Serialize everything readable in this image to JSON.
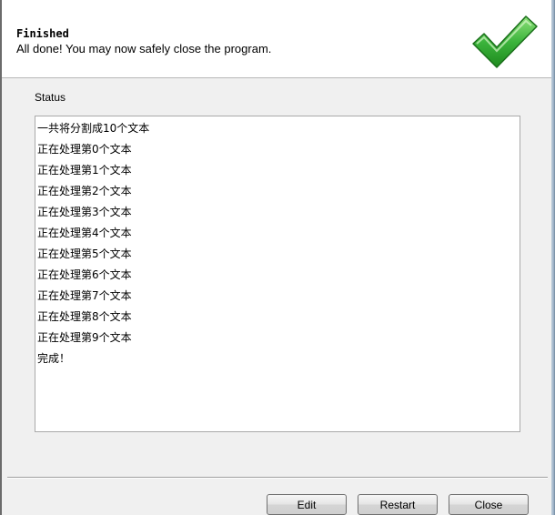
{
  "header": {
    "title": "Finished",
    "subtitle": "All done! You may now safely close the program.",
    "icon": "checkmark-icon",
    "icon_color": "#2ea52e"
  },
  "status": {
    "label": "Status",
    "lines": [
      "一共将分割成10个文本",
      "正在处理第0个文本",
      "正在处理第1个文本",
      "正在处理第2个文本",
      "正在处理第3个文本",
      "正在处理第4个文本",
      "正在处理第5个文本",
      "正在处理第6个文本",
      "正在处理第7个文本",
      "正在处理第8个文本",
      "正在处理第9个文本",
      "完成！"
    ]
  },
  "buttons": {
    "edit": "Edit",
    "restart": "Restart",
    "close": "Close"
  }
}
